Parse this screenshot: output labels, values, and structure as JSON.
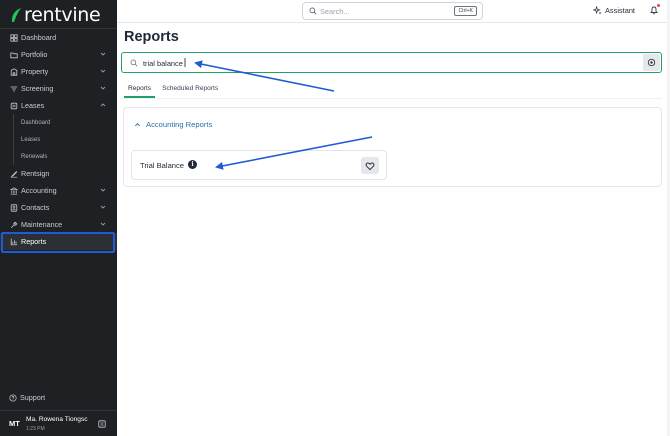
{
  "app": {
    "logo_text": "rentvine"
  },
  "sidebar": {
    "items": [
      {
        "label": "Dashboard",
        "icon": "grid-icon",
        "chevron": "none"
      },
      {
        "label": "Portfolio",
        "icon": "folder-icon",
        "chevron": "down"
      },
      {
        "label": "Property",
        "icon": "building-icon",
        "chevron": "down"
      },
      {
        "label": "Screening",
        "icon": "filter-icon",
        "chevron": "down"
      },
      {
        "label": "Leases",
        "icon": "lease-icon",
        "chevron": "up"
      }
    ],
    "subitems": [
      {
        "label": "Dashboard"
      },
      {
        "label": "Leases"
      },
      {
        "label": "Renewals"
      }
    ],
    "items2": [
      {
        "label": "Rentsign",
        "icon": "sign-icon",
        "chevron": "none"
      },
      {
        "label": "Accounting",
        "icon": "bank-icon",
        "chevron": "down"
      },
      {
        "label": "Contacts",
        "icon": "contacts-icon",
        "chevron": "down"
      },
      {
        "label": "Maintenance",
        "icon": "wrench-icon",
        "chevron": "down"
      },
      {
        "label": "Reports",
        "icon": "chart-icon",
        "chevron": "none"
      }
    ],
    "support_label": "Support",
    "user": {
      "initials": "MT",
      "name": "Ma. Rowena Tiongsc",
      "time": "1:23 PM"
    }
  },
  "topbar": {
    "search_placeholder": "Search...",
    "shortcut": "Ctrl+K",
    "assistant_label": "Assistant"
  },
  "main": {
    "title": "Reports",
    "search_value": "trial balance",
    "tabs": [
      {
        "label": "Reports"
      },
      {
        "label": "Scheduled Reports"
      }
    ],
    "section_title": "Accounting Reports",
    "report_card": {
      "label": "Trial Balance"
    }
  },
  "colors": {
    "accent_green": "#22a06b",
    "link_blue": "#2a6fa8",
    "annotation_blue": "#1f5bd6",
    "sidebar_bg": "#1e2124"
  }
}
